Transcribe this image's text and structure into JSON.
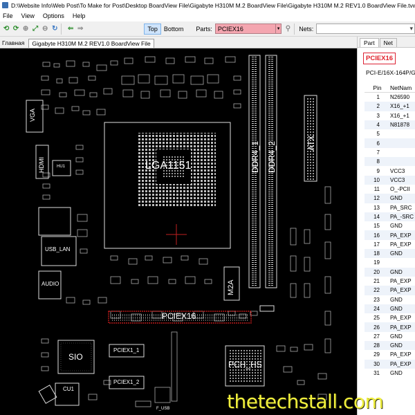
{
  "window": {
    "title": "D:\\Website Info\\Web Post\\To Make for Post\\Desktop BoardView File\\Gigabyte H310M M.2 BoardView File\\Gigabyte H310M M.2 REV1.0 BoardView File.tvw"
  },
  "menu": [
    "File",
    "View",
    "Options",
    "Help"
  ],
  "toolbar": {
    "top_label": "Top",
    "bottom_label": "Bottom",
    "parts_label": "Parts:",
    "parts_value": "PCIEX16",
    "nets_label": "Nets:",
    "nets_value": ""
  },
  "tabs": {
    "home": "Главная",
    "file": "Gigabyte H310M M.2 REV1.0 BoardView File"
  },
  "board": {
    "labels": {
      "cpu": "LGA1151",
      "ddr1": "DDR4_1",
      "ddr2": "DDR4_2",
      "atx": "ATX",
      "vga": "VGA",
      "hdmi": "HDMI",
      "hdmi_small": "HU1",
      "usb_lan": "USB_LAN",
      "audio": "AUDIO",
      "m2a": "M2A",
      "pciex16": "PCIEX16",
      "sio": "SIO",
      "pciex1_1": "PCIEX1_1",
      "pciex1_2": "PCIEX1_2",
      "pch": "PCH_HS",
      "cu1": "CU1",
      "f_usb": "F_USB"
    }
  },
  "panel": {
    "tabs": [
      "Part",
      "Net"
    ],
    "part_name": "PCIEX16",
    "part_desc": "PCI-E/16X-164P/G",
    "columns": [
      "Pin",
      "NetNam"
    ],
    "rows": [
      {
        "pin": "1",
        "net": "N26590"
      },
      {
        "pin": "2",
        "net": "X16_+1"
      },
      {
        "pin": "3",
        "net": "X16_+1"
      },
      {
        "pin": "4",
        "net": "N81878"
      },
      {
        "pin": "5",
        "net": ""
      },
      {
        "pin": "6",
        "net": ""
      },
      {
        "pin": "7",
        "net": ""
      },
      {
        "pin": "8",
        "net": ""
      },
      {
        "pin": "9",
        "net": "VCC3"
      },
      {
        "pin": "10",
        "net": "VCC3"
      },
      {
        "pin": "11",
        "net": "O_-PCII"
      },
      {
        "pin": "12",
        "net": "GND"
      },
      {
        "pin": "13",
        "net": "PA_SRC"
      },
      {
        "pin": "14",
        "net": "PA_-SRC"
      },
      {
        "pin": "15",
        "net": "GND"
      },
      {
        "pin": "16",
        "net": "PA_EXP"
      },
      {
        "pin": "17",
        "net": "PA_EXP"
      },
      {
        "pin": "18",
        "net": "GND"
      },
      {
        "pin": "19",
        "net": ""
      },
      {
        "pin": "20",
        "net": "GND"
      },
      {
        "pin": "21",
        "net": "PA_EXP"
      },
      {
        "pin": "22",
        "net": "PA_EXP"
      },
      {
        "pin": "23",
        "net": "GND"
      },
      {
        "pin": "24",
        "net": "GND"
      },
      {
        "pin": "25",
        "net": "PA_EXP"
      },
      {
        "pin": "26",
        "net": "PA_EXP"
      },
      {
        "pin": "27",
        "net": "GND"
      },
      {
        "pin": "28",
        "net": "GND"
      },
      {
        "pin": "29",
        "net": "PA_EXP"
      },
      {
        "pin": "30",
        "net": "PA_EXP"
      },
      {
        "pin": "31",
        "net": "GND"
      }
    ]
  },
  "watermark": "thetechstall.com",
  "colors": {
    "board_bg": "#000000",
    "highlight": "#e02020",
    "parts_field": "#f4a6b0",
    "part_badge": "#e0202a",
    "watermark": "#f0ef3c"
  },
  "icons": [
    "back-arrow-icon",
    "forward-arrow-icon",
    "zoom-in-icon",
    "zoom-fit-icon",
    "zoom-out-icon",
    "rotate-icon",
    "flip-left-icon",
    "flip-right-icon",
    "search-parts-icon"
  ]
}
